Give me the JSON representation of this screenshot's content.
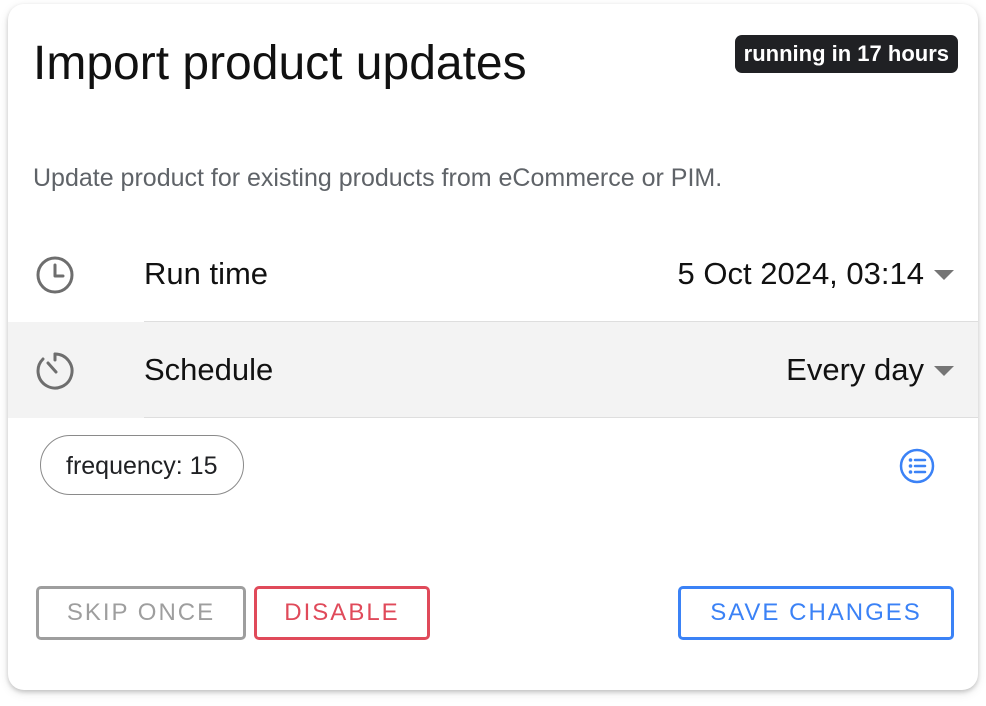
{
  "card": {
    "title": "Import product updates",
    "status_badge": "running in 17 hours",
    "description": "Update product for existing products from eCommerce or PIM."
  },
  "settings": {
    "run_time": {
      "icon": "clock-icon",
      "label": "Run time",
      "value": "5 Oct 2024, 03:14"
    },
    "schedule": {
      "icon": "timer-icon",
      "label": "Schedule",
      "value": "Every day"
    }
  },
  "params": {
    "chip": "frequency: 15",
    "list_icon": "list-icon"
  },
  "actions": {
    "skip_label": "SKIP ONCE",
    "disable_label": "DISABLE",
    "save_label": "SAVE CHANGES"
  },
  "colors": {
    "badge_bg": "#202124",
    "accent_blue": "#3b82f6",
    "danger_red": "#e04a5a",
    "muted_gray": "#9e9e9e",
    "schedule_row_bg": "#f3f3f3"
  }
}
